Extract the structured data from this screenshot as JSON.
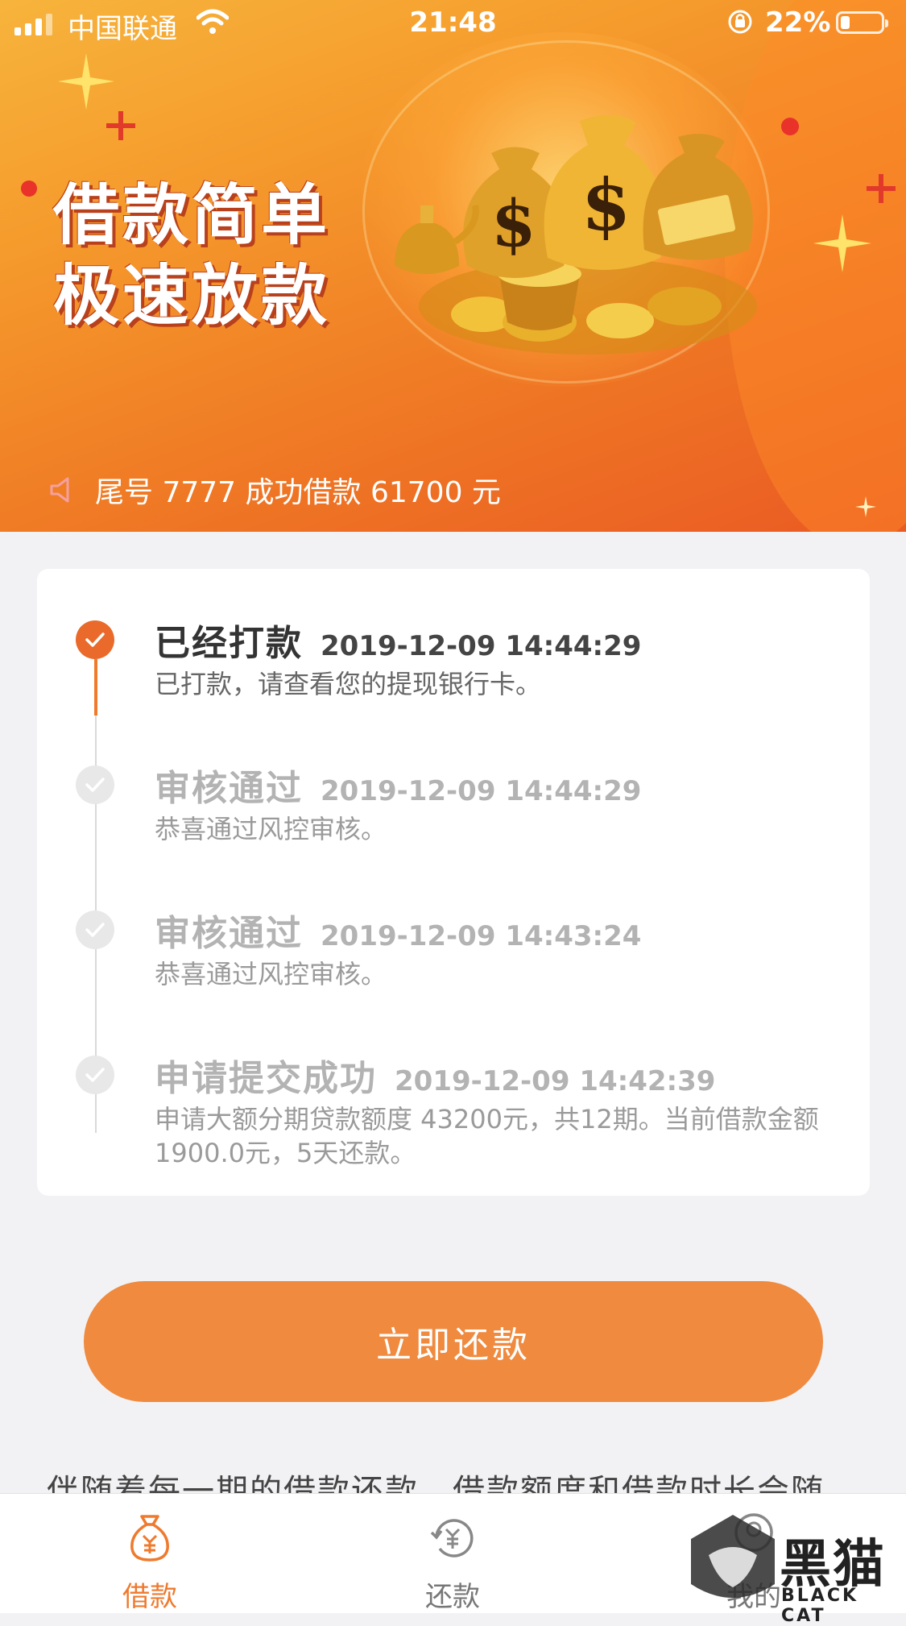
{
  "status_bar": {
    "carrier": "中国联通",
    "time": "21:48",
    "battery": "22%",
    "battery_level_percent": 22
  },
  "banner": {
    "slogan_line1": "借款简单",
    "slogan_line2": "极速放款",
    "notice": "尾号 7777 成功借款 61700 元",
    "notice_icon": "speaker-icon"
  },
  "progress": {
    "steps": [
      {
        "title": "已经打款",
        "time": "2019-12-09 14:44:29",
        "desc": "已打款，请查看您的提现银行卡。"
      },
      {
        "title": "审核通过",
        "time": "2019-12-09 14:44:29",
        "desc": "恭喜通过风控审核。"
      },
      {
        "title": "审核通过",
        "time": "2019-12-09 14:43:24",
        "desc": "恭喜通过风控审核。"
      },
      {
        "title": "申请提交成功",
        "time": "2019-12-09 14:42:39",
        "desc": "申请大额分期贷款额度 43200元，共12期。当前借款金额1900.0元，5天还款。"
      }
    ]
  },
  "repay_button": "立即还款",
  "footer_note": "伴随着每一期的借款还款，借款额度和借款时长会随",
  "tabs": [
    {
      "label": "借款",
      "icon": "money-bag-icon"
    },
    {
      "label": "还款",
      "icon": "repay-cycle-icon"
    },
    {
      "label": "我的",
      "icon": "profile-icon"
    }
  ],
  "watermark": {
    "text": "黑猫",
    "sub": "BLACK CAT"
  },
  "colors": {
    "accent": "#ef7a2e",
    "button": "#ef8a3f",
    "banner_start": "#f7b43c",
    "banner_end": "#ea5a23"
  }
}
